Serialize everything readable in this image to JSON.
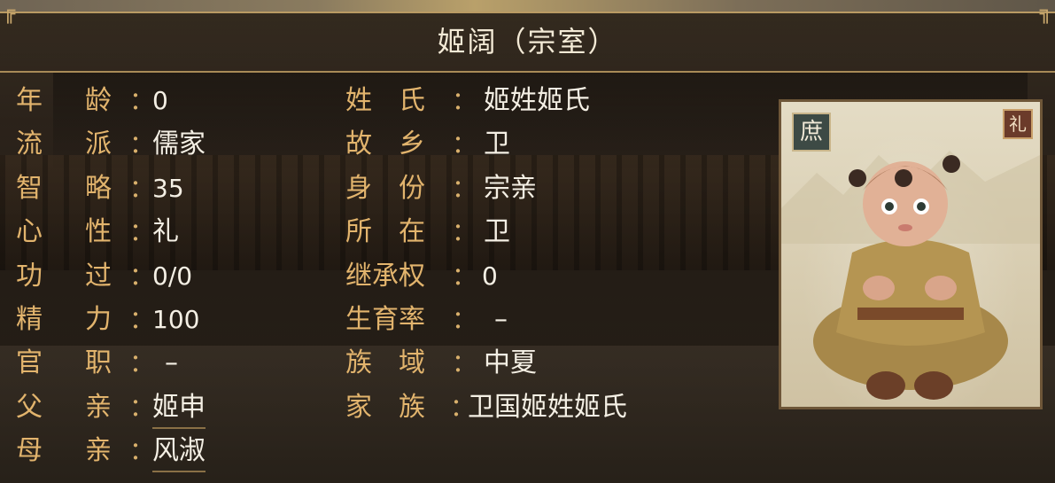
{
  "header": {
    "title": "姬阔（宗室）"
  },
  "left_rows": [
    {
      "label_a": "年",
      "label_b": "龄",
      "value": "0"
    },
    {
      "label_a": "流",
      "label_b": "派",
      "value": "儒家"
    },
    {
      "label_a": "智",
      "label_b": "略",
      "value": "35"
    },
    {
      "label_a": "心",
      "label_b": "性",
      "value": "礼"
    },
    {
      "label_a": "功",
      "label_b": "过",
      "value": "0/0"
    },
    {
      "label_a": "精",
      "label_b": "力",
      "value": "100"
    },
    {
      "label_a": "官",
      "label_b": "职",
      "value": "–"
    },
    {
      "label_a": "父",
      "label_b": "亲",
      "value": "姬申"
    },
    {
      "label_a": "母",
      "label_b": "亲",
      "value": "风淑"
    }
  ],
  "right_rows": [
    {
      "label": "姓　氏",
      "value": "姬姓姬氏"
    },
    {
      "label": "故　乡",
      "value": "卫"
    },
    {
      "label": "身　份",
      "value": "宗亲"
    },
    {
      "label": "所　在",
      "value": "卫"
    },
    {
      "label": "继承权",
      "value": "0"
    },
    {
      "label": "生育率",
      "value": "–"
    },
    {
      "label": "族　域",
      "value": "中夏"
    },
    {
      "label": "家　族",
      "value": "卫国姬姓姬氏"
    }
  ],
  "colon": "：",
  "portrait": {
    "badge_left": "庶",
    "badge_right": "礼"
  },
  "colors": {
    "label": "#e2b46d",
    "value": "#f4efe4",
    "border": "#b99a63"
  }
}
